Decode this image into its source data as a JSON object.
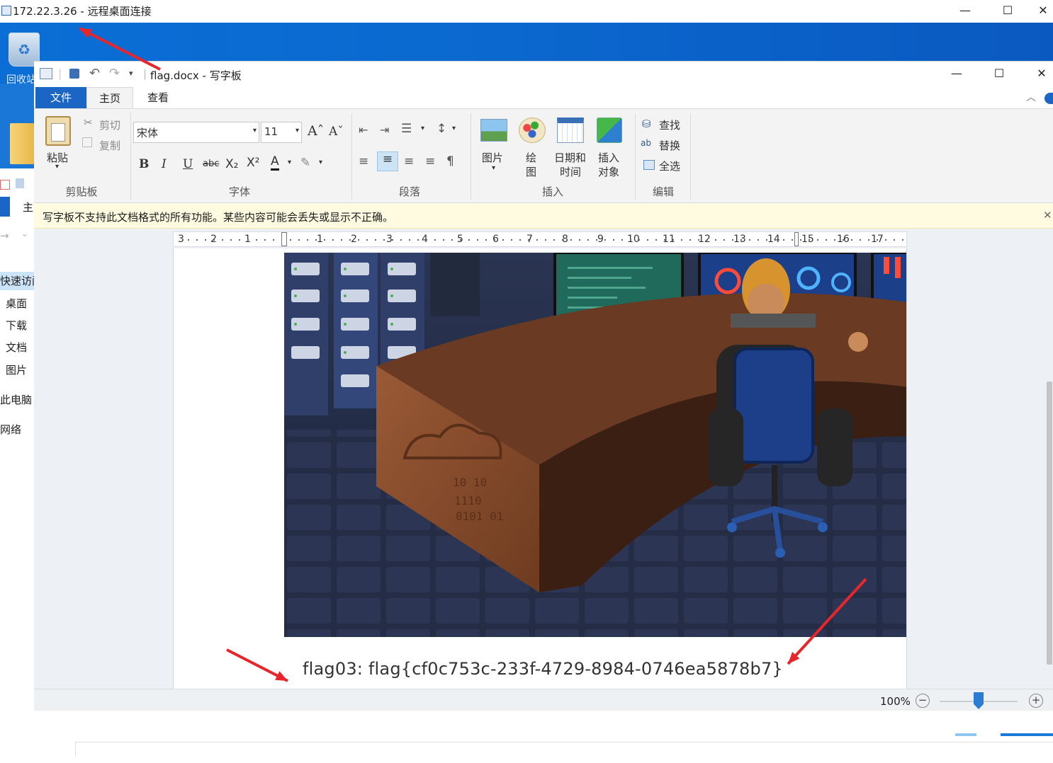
{
  "rdp": {
    "title": "172.22.3.26 - 远程桌面连接",
    "minimize": "—",
    "maximize": "☐",
    "close": "✕"
  },
  "desktop": {
    "recycle_bin_label": "回收站"
  },
  "explorer": {
    "items": [
      "主",
      "快速访问",
      "桌面",
      "下载",
      "文档",
      "图片",
      "此电脑",
      "网络"
    ]
  },
  "wordpad": {
    "document_title": "flag.docx - 写字板",
    "minimize": "—",
    "maximize": "☐",
    "close": "✕",
    "tabs": [
      "文件",
      "主页",
      "查看"
    ],
    "clipboard": {
      "paste": "粘贴",
      "cut": "剪切",
      "copy": "复制",
      "group_label": "剪贴板"
    },
    "font": {
      "family": "宋体",
      "size": "11",
      "group_label": "字体"
    },
    "paragraph": {
      "group_label": "段落"
    },
    "insert": {
      "picture": "图片",
      "paint_line1": "绘",
      "paint_line2": "图",
      "datetime_line1": "日期和",
      "datetime_line2": "时间",
      "object_line1": "插入",
      "object_line2": "对象",
      "group_label": "插入"
    },
    "editing": {
      "find": "查找",
      "replace": "替换",
      "select_all": "全选",
      "group_label": "编辑"
    },
    "infobar_message": "写字板不支持此文档格式的所有功能。某些内容可能会丢失或显示不正确。",
    "ruler_numbers": [
      "3",
      "2",
      "1",
      "1",
      "2",
      "3",
      "4",
      "5",
      "6",
      "7",
      "8",
      "9",
      "10",
      "11",
      "12",
      "13",
      "14",
      "15",
      "16",
      "17"
    ],
    "document_text": "flag03: flag{cf0c753c-233f-4729-8984-0746ea5878b7}",
    "zoom": "100%",
    "zoom_percent": 100
  },
  "annotation_color": "#e8262a"
}
